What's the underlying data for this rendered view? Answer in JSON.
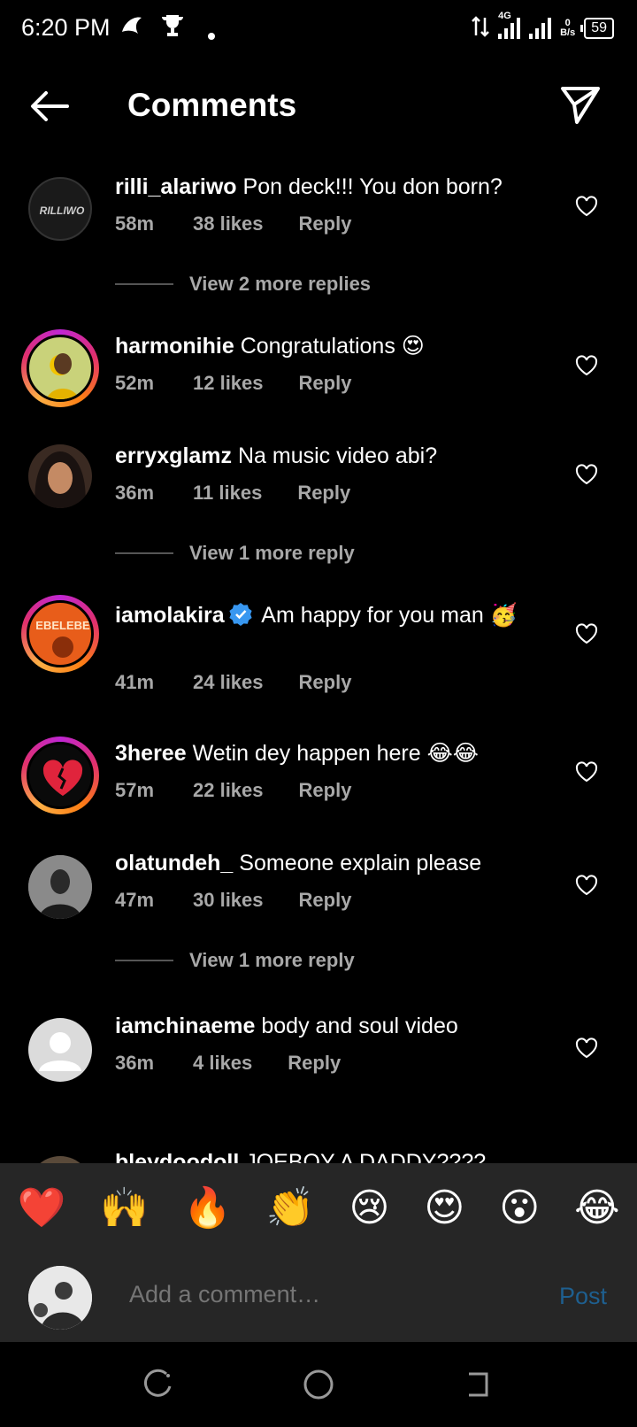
{
  "status_bar": {
    "time": "6:20 PM",
    "network": "4G",
    "data_speed": "0",
    "data_unit": "B/s",
    "battery": "59"
  },
  "header": {
    "title": "Comments"
  },
  "comments": [
    {
      "user": "rilli_alariwo",
      "text": "Pon deck!!! You don born?",
      "time": "58m",
      "likes": "38 likes",
      "reply": "Reply",
      "more": "View 2 more replies"
    },
    {
      "user": "harmonihie",
      "text": "Congratulations 😍",
      "time": "52m",
      "likes": "12 likes",
      "reply": "Reply"
    },
    {
      "user": "erryxglamz",
      "text": "Na music video abi?",
      "time": "36m",
      "likes": "11 likes",
      "reply": "Reply",
      "more": "View 1 more reply"
    },
    {
      "user": "iamolakira",
      "text": "Am happy for you man 🥳",
      "time": "41m",
      "likes": "24 likes",
      "reply": "Reply"
    },
    {
      "user": "3heree",
      "text": "Wetin dey happen here 😂😂",
      "time": "57m",
      "likes": "22 likes",
      "reply": "Reply"
    },
    {
      "user": "olatundeh_",
      "text": "Someone explain please",
      "time": "47m",
      "likes": "30 likes",
      "reply": "Reply",
      "more": "View 1 more reply"
    },
    {
      "user": "iamchinaeme",
      "text": "body and soul video",
      "time": "36m",
      "likes": "4 likes",
      "reply": "Reply"
    },
    {
      "user": "bleydoodoll",
      "text": "JOEBOY A DADDY????"
    }
  ],
  "avatar_labels": {
    "rilli": "RILLIWO",
    "olakira": "EBELEBE"
  },
  "emoji_bar": [
    "❤️",
    "🙌",
    "🔥",
    "👏",
    "😢",
    "😍",
    "😮",
    "😂"
  ],
  "composer": {
    "placeholder": "Add a comment…",
    "post_label": "Post"
  },
  "colors": {
    "background": "#000000",
    "secondary_text": "#a8a8a8",
    "post_link": "#1e5f8f",
    "verified": "#3897f0",
    "panel": "#262626"
  }
}
